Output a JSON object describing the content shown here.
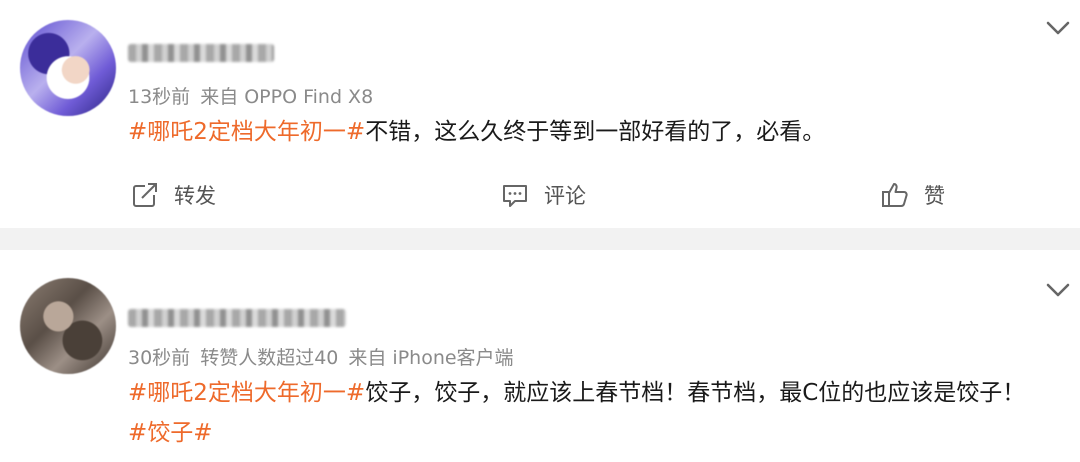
{
  "posts": [
    {
      "time": "13秒前",
      "source": "来自 OPPO Find X8",
      "extra": "",
      "topic": "#哪吒2定档大年初一#",
      "body": "不错，这么久终于等到一部好看的了，必看。",
      "tag2": "",
      "actions": {
        "repost": "转发",
        "comment": "评论",
        "like": "赞"
      }
    },
    {
      "time": "30秒前",
      "extra": "转赞人数超过40",
      "source": "来自 iPhone客户端",
      "topic": "#哪吒2定档大年初一#",
      "body": "饺子，饺子，就应该上春节档！春节档，最C位的也应该是饺子！",
      "tag2": "#饺子#"
    }
  ],
  "icons": {
    "collapse": "chevron-down-icon",
    "repost": "repost-icon",
    "comment": "comment-icon",
    "like": "thumbs-up-icon"
  },
  "colors": {
    "topic": "#ee6a2b",
    "meta": "#8a8a8a",
    "separator": "#f2f2f2"
  }
}
